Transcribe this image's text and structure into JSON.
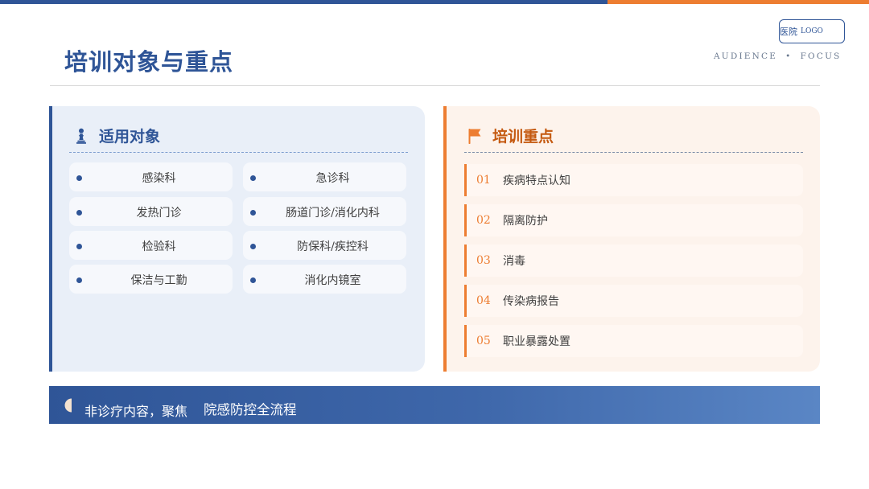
{
  "header": {
    "title": "培训对象与重点",
    "subtitle_left": "AUDIENCE",
    "subtitle_sep": "•",
    "subtitle_right": "FOCUS",
    "logo_main": "医院",
    "logo_sub": "LOGO"
  },
  "audience": {
    "heading": "适用对象",
    "icon": "chess-pawn-icon",
    "items": [
      "感染科",
      "急诊科",
      "发热门诊",
      "肠道门诊/消化内科",
      "检验科",
      "防保科/疾控科",
      "保洁与工勤",
      "消化内镜室"
    ]
  },
  "focus": {
    "heading": "培训重点",
    "icon": "flag-icon",
    "items": [
      {
        "num": "01",
        "text": "疾病特点认知"
      },
      {
        "num": "02",
        "text": "隔离防护"
      },
      {
        "num": "03",
        "text": "消毒"
      },
      {
        "num": "04",
        "text": "传染病报告"
      },
      {
        "num": "05",
        "text": "职业暴露处置"
      }
    ]
  },
  "banner": {
    "icon": "half-circle-icon",
    "text_1": "非诊疗内容，聚焦",
    "text_2": "院感防控全流程"
  },
  "colors": {
    "primary_blue": "#2f5597",
    "accent_orange": "#ed7d31",
    "text_dark": "#404040"
  }
}
